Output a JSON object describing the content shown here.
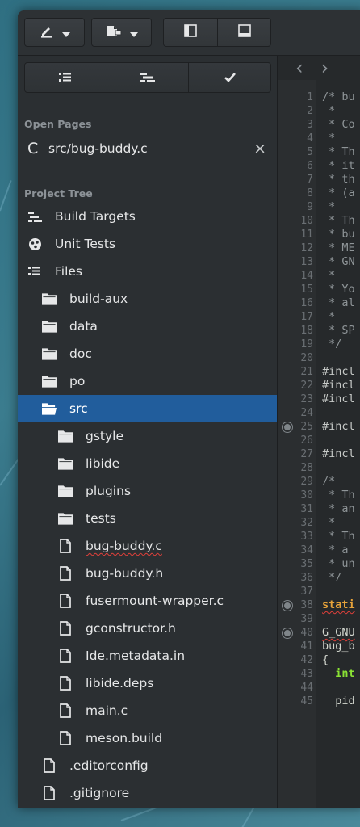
{
  "sidebar": {
    "open_pages_title": "Open Pages",
    "open_page": {
      "letter": "C",
      "name": "src/bug-buddy.c",
      "close_label": "×"
    },
    "project_tree_title": "Project Tree",
    "tree": [
      {
        "label": "Build Targets",
        "icon": "build-targets-icon",
        "indent": 0
      },
      {
        "label": "Unit Tests",
        "icon": "unit-tests-icon",
        "indent": 0
      },
      {
        "label": "Files",
        "icon": "files-icon",
        "indent": 0
      },
      {
        "label": "build-aux",
        "icon": "folder-icon",
        "indent": 1
      },
      {
        "label": "data",
        "icon": "folder-icon",
        "indent": 1
      },
      {
        "label": "doc",
        "icon": "folder-icon",
        "indent": 1
      },
      {
        "label": "po",
        "icon": "folder-icon",
        "indent": 1
      },
      {
        "label": "src",
        "icon": "folder-open-icon",
        "indent": 1,
        "selected": true
      },
      {
        "label": "gstyle",
        "icon": "folder-icon",
        "indent": 2
      },
      {
        "label": "libide",
        "icon": "folder-icon",
        "indent": 2
      },
      {
        "label": "plugins",
        "icon": "folder-icon",
        "indent": 2
      },
      {
        "label": "tests",
        "icon": "folder-icon",
        "indent": 2
      },
      {
        "label": "bug-buddy.c",
        "icon": "file-icon",
        "indent": 2,
        "spell_error": true
      },
      {
        "label": "bug-buddy.h",
        "icon": "file-icon",
        "indent": 2
      },
      {
        "label": "fusermount-wrapper.c",
        "icon": "file-icon",
        "indent": 2
      },
      {
        "label": "gconstructor.h",
        "icon": "file-icon",
        "indent": 2
      },
      {
        "label": "Ide.metadata.in",
        "icon": "file-icon",
        "indent": 2
      },
      {
        "label": "libide.deps",
        "icon": "file-icon",
        "indent": 2
      },
      {
        "label": "main.c",
        "icon": "file-icon",
        "indent": 2
      },
      {
        "label": "meson.build",
        "icon": "file-icon",
        "indent": 2
      },
      {
        "label": ".editorconfig",
        "icon": "file-icon",
        "indent": 1
      },
      {
        "label": ".gitignore",
        "icon": "file-icon",
        "indent": 1
      }
    ]
  },
  "editor": {
    "nav_back": "‹",
    "nav_forward": "›",
    "lines": [
      {
        "n": "1",
        "text": "/* bu",
        "cls": "cm"
      },
      {
        "n": "2",
        "text": " *",
        "cls": "cm"
      },
      {
        "n": "3",
        "text": " * Co",
        "cls": "cm"
      },
      {
        "n": "4",
        "text": " *",
        "cls": "cm"
      },
      {
        "n": "5",
        "text": " * Th",
        "cls": "cm"
      },
      {
        "n": "6",
        "text": " * it",
        "cls": "cm"
      },
      {
        "n": "7",
        "text": " * th",
        "cls": "cm"
      },
      {
        "n": "8",
        "text": " * (a",
        "cls": "cm"
      },
      {
        "n": "9",
        "text": " *",
        "cls": "cm"
      },
      {
        "n": "10",
        "text": " * Th",
        "cls": "cm"
      },
      {
        "n": "11",
        "text": " * bu",
        "cls": "cm"
      },
      {
        "n": "12",
        "text": " * ME",
        "cls": "cm"
      },
      {
        "n": "13",
        "text": " * GN",
        "cls": "cm"
      },
      {
        "n": "14",
        "text": " *",
        "cls": "cm"
      },
      {
        "n": "15",
        "text": " * Yo",
        "cls": "cm"
      },
      {
        "n": "16",
        "text": " * al",
        "cls": "cm"
      },
      {
        "n": "17",
        "text": " *",
        "cls": "cm"
      },
      {
        "n": "18",
        "text": " * SP",
        "cls": "cm"
      },
      {
        "n": "19",
        "text": " */",
        "cls": "cm"
      },
      {
        "n": "20",
        "text": "",
        "cls": "cm"
      },
      {
        "n": "21",
        "text": "#incl",
        "cls": "pp"
      },
      {
        "n": "22",
        "text": "#incl",
        "cls": "pp"
      },
      {
        "n": "23",
        "text": "#incl",
        "cls": "pp"
      },
      {
        "n": "24",
        "text": "",
        "cls": "pp"
      },
      {
        "n": "25",
        "text": "#incl",
        "cls": "pp",
        "mark": true
      },
      {
        "n": "26",
        "text": "",
        "cls": "pp"
      },
      {
        "n": "27",
        "text": "#incl",
        "cls": "pp"
      },
      {
        "n": "28",
        "text": "",
        "cls": "pp"
      },
      {
        "n": "29",
        "text": "/*",
        "cls": "cm"
      },
      {
        "n": "30",
        "text": " * Th",
        "cls": "cm"
      },
      {
        "n": "31",
        "text": " * an",
        "cls": "cm"
      },
      {
        "n": "32",
        "text": " *",
        "cls": "cm"
      },
      {
        "n": "33",
        "text": " * Th",
        "cls": "cm"
      },
      {
        "n": "34",
        "text": " * a",
        "cls": "cm"
      },
      {
        "n": "35",
        "text": " * un",
        "cls": "cm"
      },
      {
        "n": "36",
        "text": " */",
        "cls": "cm"
      },
      {
        "n": "37",
        "text": "",
        "cls": "cm"
      },
      {
        "n": "38",
        "text": "stati",
        "cls": "kw",
        "mark": true,
        "wavy": true
      },
      {
        "n": "39",
        "text": "",
        "cls": "id"
      },
      {
        "n": "40",
        "text": "G_GNU",
        "cls": "id",
        "mark": true,
        "wavy": true
      },
      {
        "n": "41",
        "text": "bug_b",
        "cls": "id"
      },
      {
        "n": "42",
        "text": "{",
        "cls": "id"
      },
      {
        "n": "43",
        "text": "  int",
        "cls": "ty"
      },
      {
        "n": "44",
        "text": "",
        "cls": "id"
      },
      {
        "n": "45",
        "text": "  pid",
        "cls": "id"
      }
    ]
  },
  "colors": {
    "selection": "#215d9c",
    "comment": "#8f9598",
    "preproc": "#c5c8c6",
    "keyword": "#e7a33a",
    "type": "#8ae234",
    "identifier": "#d3d7cf"
  }
}
